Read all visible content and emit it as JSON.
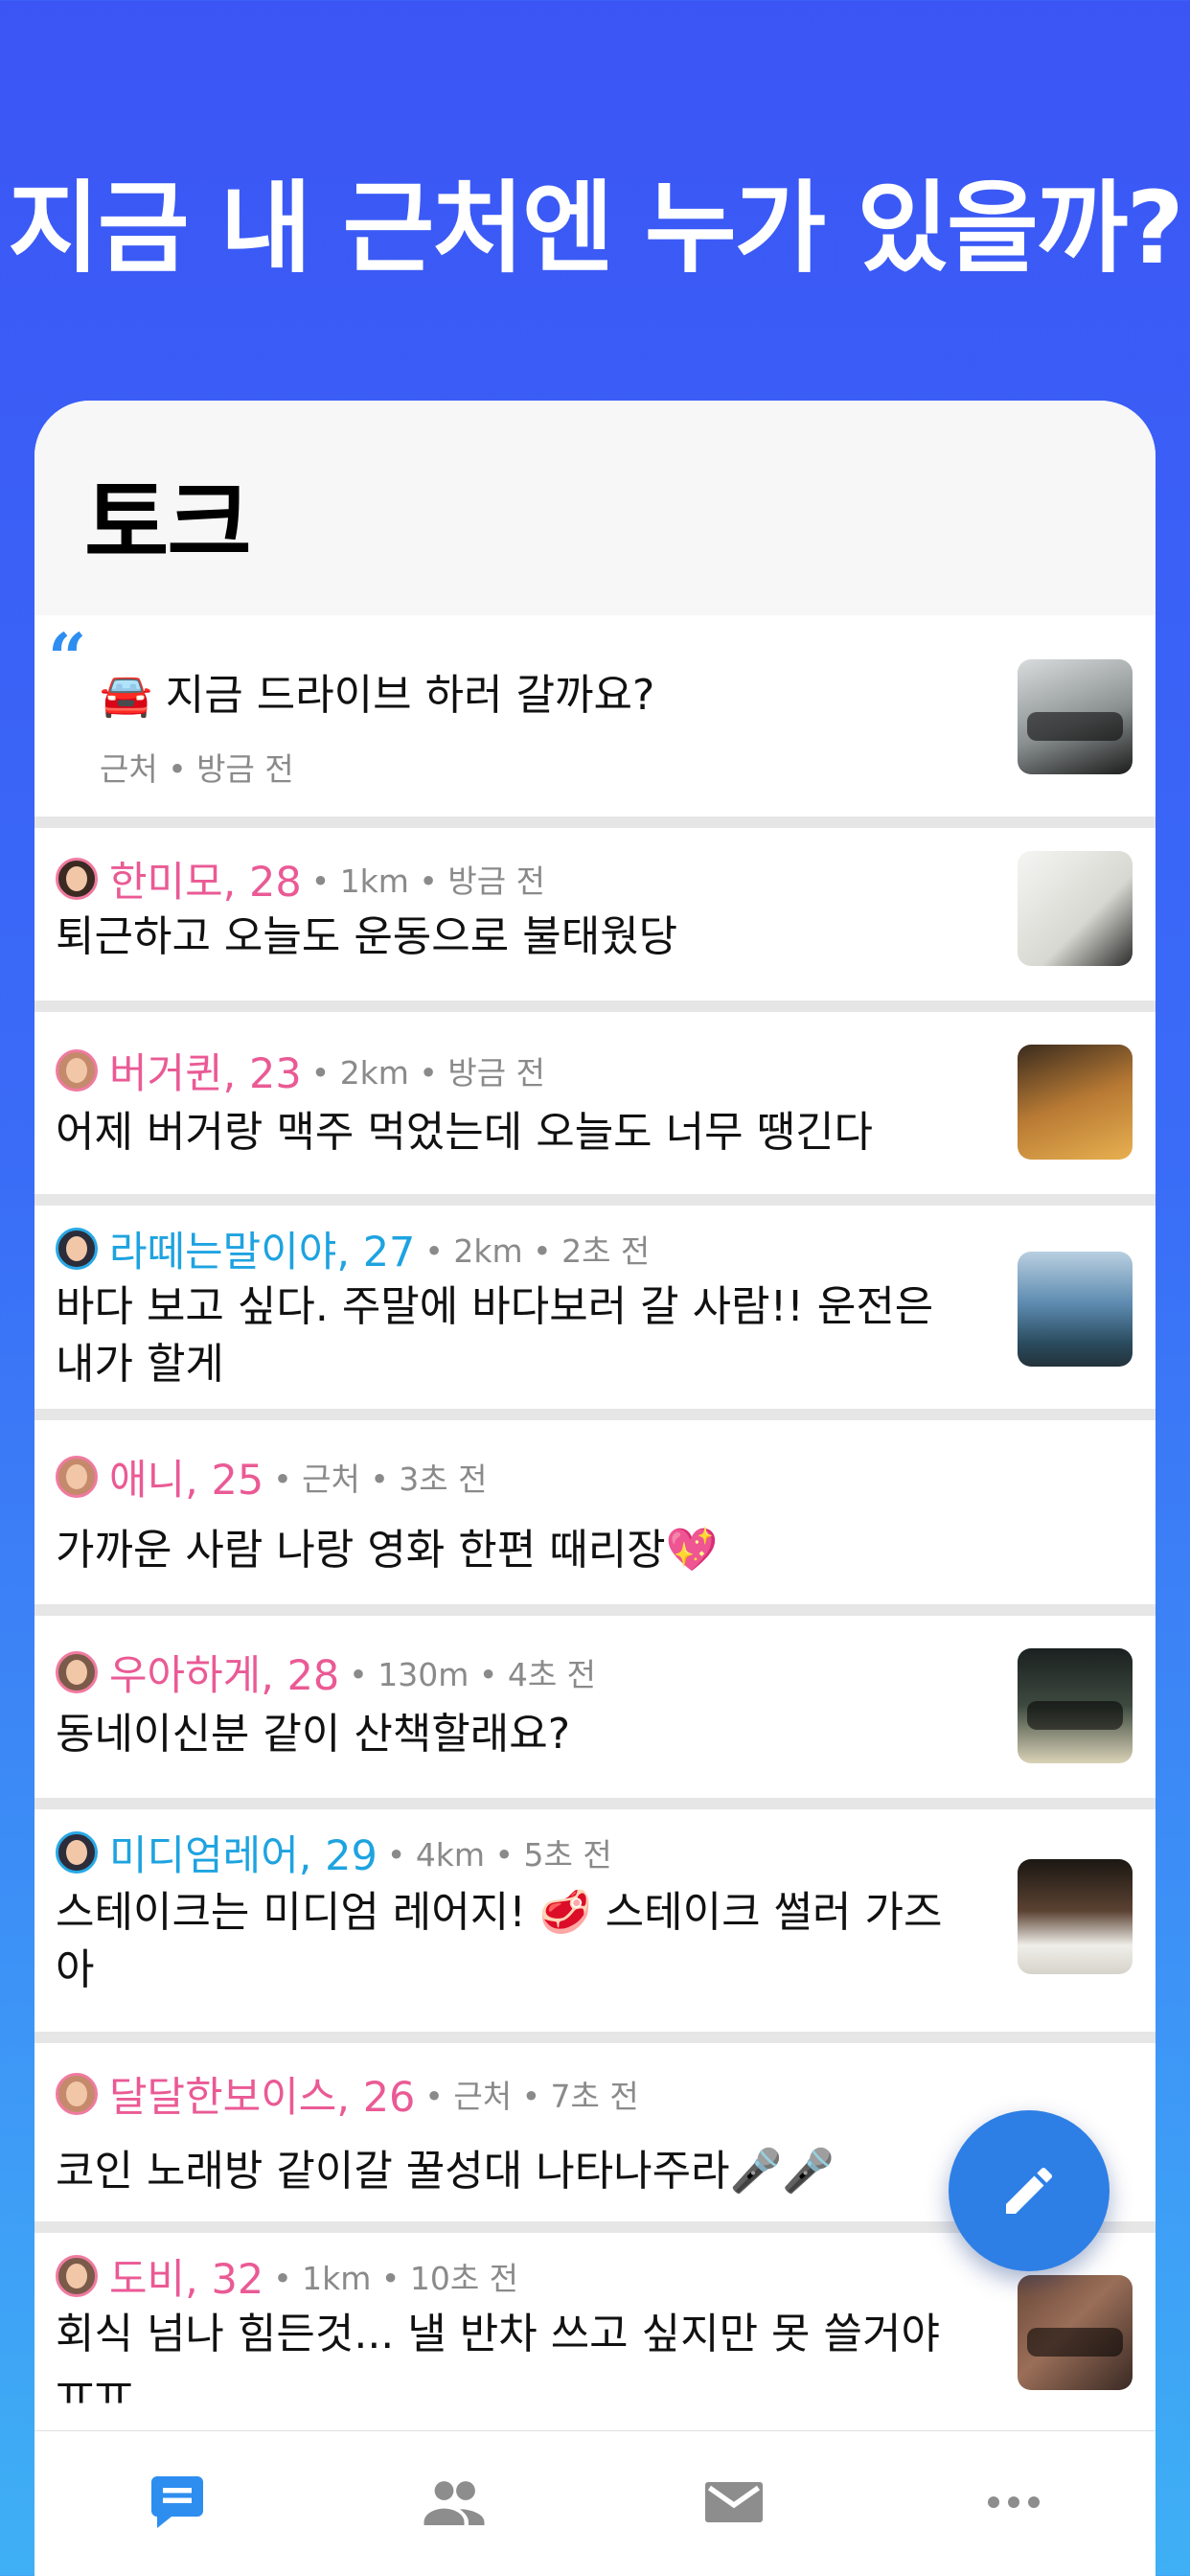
{
  "headline": "지금 내 근처엔 누가 있을까?",
  "screen_title": "토크",
  "pinned_post": {
    "quote_glyph": "“",
    "text": "🚘 지금 드라이브 하러 갈까요?",
    "meta": "근처 • 방금 전"
  },
  "posts": [
    {
      "name": "한미모, 28",
      "meta": "• 1km • 방금 전",
      "text": "퇴근하고 오늘도 운동으로 불태웠당"
    },
    {
      "name": "버거퀸, 23",
      "meta": "• 2km • 방금 전",
      "text": "어제 버거랑 맥주 먹었는데 오늘도 너무 땡긴다"
    },
    {
      "name": "라떼는말이야, 27",
      "meta": "• 2km • 2초 전",
      "text": "바다 보고 싶다. 주말에 바다보러 갈 사람!! 운전은 내가 할게"
    },
    {
      "name": "애니, 25",
      "meta": "• 근처 • 3초 전",
      "text": "가까운 사람 나랑 영화 한편 때리장💖"
    },
    {
      "name": "우아하게, 28",
      "meta": "• 130m • 4초 전",
      "text": "동네이신분 같이 산책할래요?"
    },
    {
      "name": "미디엄레어, 29",
      "meta": "• 4km • 5초 전",
      "text": "스테이크는 미디엄 레어지! 🥩  스테이크 썰러 가즈아"
    },
    {
      "name": "달달한보이스, 26",
      "meta": "• 근처 • 7초 전",
      "text": "코인 노래방 같이갈 꿀성대 나타나주라🎤🎤"
    },
    {
      "name": "도비, 32",
      "meta": "• 1km • 10초 전",
      "text": "회식 넘나 힘든것... 낼 반차 쓰고 싶지만 못 쓸거야 ㅠㅠ"
    }
  ],
  "tabs": [
    "chat-icon",
    "people-icon",
    "mail-icon",
    "more-icon"
  ],
  "colors": {
    "accent": "#2d8ef0",
    "female_name": "#ea5a95",
    "male_name": "#1ea3e0",
    "fab": "#2d7fe6"
  }
}
